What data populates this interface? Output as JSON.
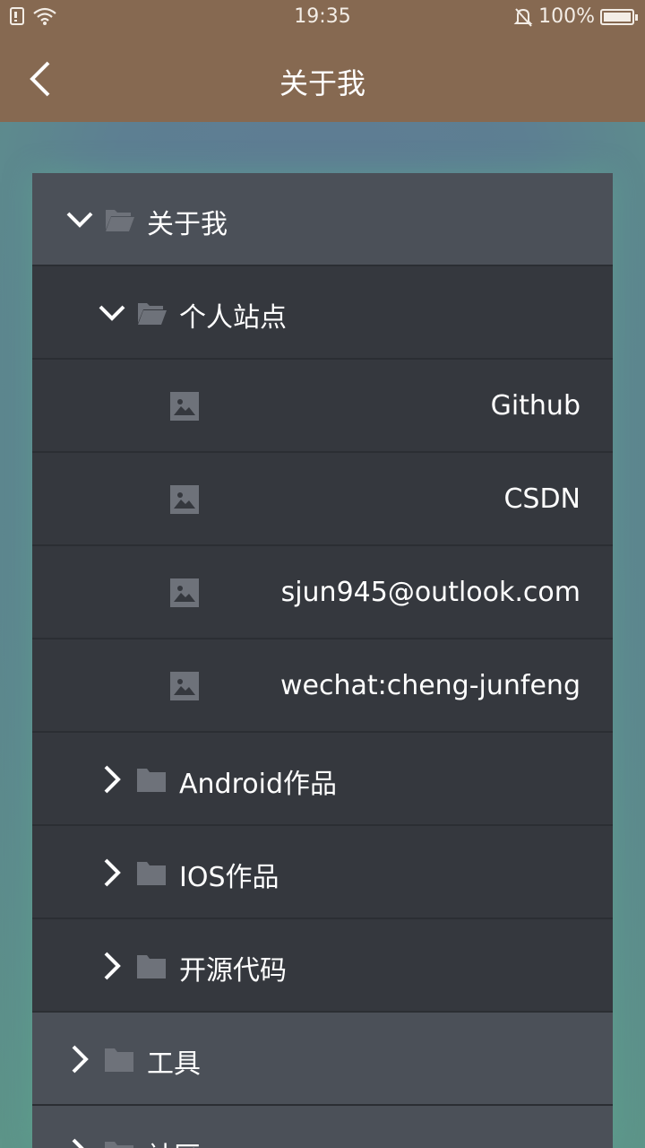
{
  "status_bar": {
    "time": "19:35",
    "battery": "100%"
  },
  "header": {
    "title": "关于我"
  },
  "tree": {
    "root": {
      "label": "关于我"
    },
    "personal_sites": {
      "label": "个人站点"
    },
    "links": [
      {
        "label": "Github"
      },
      {
        "label": "CSDN"
      },
      {
        "label": "sjun945@outlook.com"
      },
      {
        "label": "wechat:cheng-junfeng"
      }
    ],
    "android": {
      "label": "Android作品"
    },
    "ios": {
      "label": "IOS作品"
    },
    "open_source": {
      "label": "开源代码"
    },
    "tools": {
      "label": "工具"
    },
    "community": {
      "label": "社区"
    }
  },
  "colors": {
    "app_bar": "#866951",
    "row_top": "#4b5058",
    "row_nested": "#35383e",
    "icon_gray": "#6e727a"
  }
}
